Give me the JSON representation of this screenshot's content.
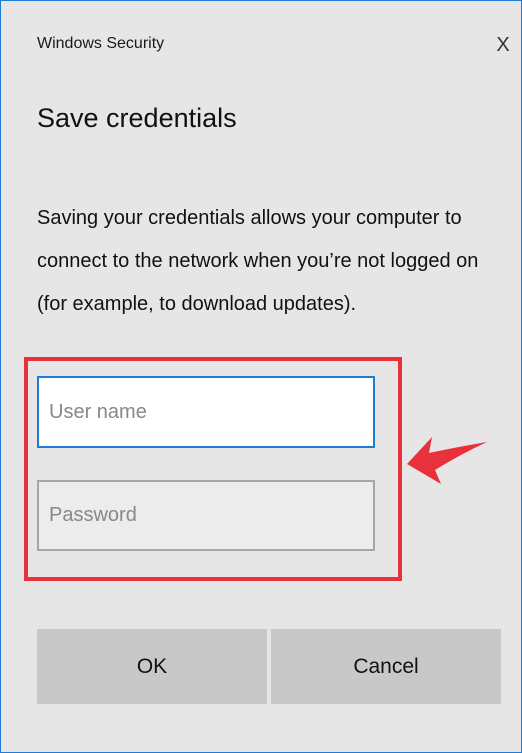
{
  "window": {
    "title": "Windows Security",
    "close_label": "X"
  },
  "heading": "Save credentials",
  "description": "Saving your credentials allows your computer to connect to the network when you’re not logged on (for example, to download updates).",
  "fields": {
    "username": {
      "value": "",
      "placeholder": "User name",
      "focused": true
    },
    "password": {
      "value": "",
      "placeholder": "Password"
    }
  },
  "buttons": {
    "ok_label": "OK",
    "cancel_label": "Cancel"
  },
  "annotation": {
    "highlight_color": "#e8313b",
    "arrow_icon": "red-arrow-left-icon"
  },
  "colors": {
    "dialog_background": "#e6e6e6",
    "focus_border": "#1e7bd6",
    "button_background": "#c8c8c8"
  }
}
